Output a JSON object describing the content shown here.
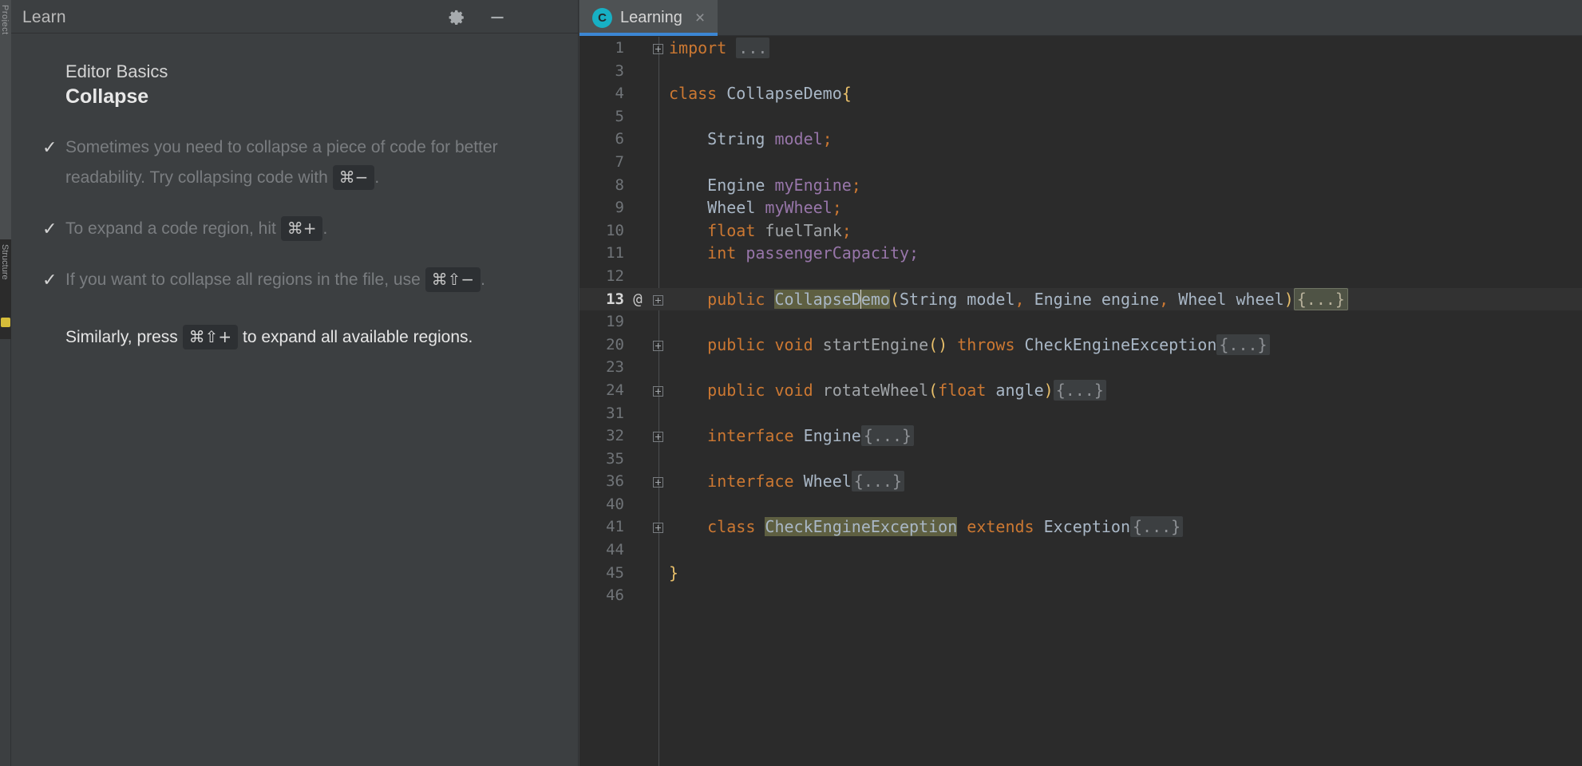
{
  "left_stripe": {
    "tab_label_top": "Project",
    "tab_label_bottom": "Structure",
    "icon_name": "bulb-icon"
  },
  "learn_panel": {
    "title": "Learn",
    "gear_icon": "gear-icon",
    "minimize_icon": "minimize-icon",
    "module": "Editor Basics",
    "lesson": "Collapse",
    "tasks": [
      {
        "state": "done",
        "check": "✓",
        "parts": [
          {
            "type": "text",
            "value": "Sometimes you need to collapse a piece of code for better readability. Try collapsing code with "
          },
          {
            "type": "kbd",
            "value": "⌘−"
          },
          {
            "type": "text",
            "value": "."
          }
        ]
      },
      {
        "state": "done",
        "check": "✓",
        "parts": [
          {
            "type": "text",
            "value": "To expand a code region, hit "
          },
          {
            "type": "kbd",
            "value": "⌘+"
          },
          {
            "type": "text",
            "value": "."
          }
        ]
      },
      {
        "state": "done",
        "check": "✓",
        "parts": [
          {
            "type": "text",
            "value": "If you want to collapse all regions in the file, use "
          },
          {
            "type": "kbd",
            "value": "⌘⇧−"
          },
          {
            "type": "text",
            "value": "."
          }
        ]
      }
    ],
    "final_note": [
      {
        "type": "text",
        "value": "Similarly, press "
      },
      {
        "type": "kbd",
        "value": "⌘⇧+"
      },
      {
        "type": "text",
        "value": " to expand all available regions."
      }
    ]
  },
  "editor": {
    "tab": {
      "icon_letter": "C",
      "icon_name": "java-class-icon",
      "label": "Learning",
      "close_icon": "×"
    },
    "colors": {
      "background": "#2b2b2b",
      "caret_line": "#323232",
      "keyword": "#cc7832",
      "type": "#a9b7c6",
      "field": "#9876aa",
      "brace": "#e8bf6a",
      "fold": "#3c3f41",
      "identifier_highlight": "#5e5f41",
      "tab_underline": "#3c86d3",
      "tab_icon": "#17b0c4"
    },
    "lines": [
      {
        "num": "1",
        "fold": true,
        "ann": "",
        "caret": false,
        "tokens": [
          {
            "c": "kw",
            "t": "import"
          },
          {
            "c": "plain",
            "t": " "
          },
          {
            "c": "fold",
            "t": "..."
          }
        ]
      },
      {
        "num": "3",
        "fold": false,
        "ann": "",
        "caret": false,
        "tokens": []
      },
      {
        "num": "4",
        "fold": false,
        "ann": "",
        "caret": false,
        "tokens": [
          {
            "c": "kw",
            "t": "class"
          },
          {
            "c": "typ",
            "t": " CollapseDemo"
          },
          {
            "c": "brace",
            "t": "{"
          }
        ]
      },
      {
        "num": "5",
        "fold": false,
        "ann": "",
        "caret": false,
        "tokens": []
      },
      {
        "num": "6",
        "fold": false,
        "ann": "",
        "caret": false,
        "tokens": [
          {
            "c": "typ",
            "t": "    String "
          },
          {
            "c": "fld",
            "t": "model"
          },
          {
            "c": "kw",
            "t": ";"
          }
        ]
      },
      {
        "num": "7",
        "fold": false,
        "ann": "",
        "caret": false,
        "tokens": []
      },
      {
        "num": "8",
        "fold": false,
        "ann": "",
        "caret": false,
        "tokens": [
          {
            "c": "typ",
            "t": "    Engine "
          },
          {
            "c": "fld",
            "t": "myEngine"
          },
          {
            "c": "kw",
            "t": ";"
          }
        ]
      },
      {
        "num": "9",
        "fold": false,
        "ann": "",
        "caret": false,
        "tokens": [
          {
            "c": "typ",
            "t": "    Wheel "
          },
          {
            "c": "fld",
            "t": "myWheel"
          },
          {
            "c": "kw",
            "t": ";"
          }
        ]
      },
      {
        "num": "10",
        "fold": false,
        "ann": "",
        "caret": false,
        "tokens": [
          {
            "c": "kw",
            "t": "    float"
          },
          {
            "c": "meth",
            "t": " fuelTank"
          },
          {
            "c": "kw",
            "t": ";"
          }
        ]
      },
      {
        "num": "11",
        "fold": false,
        "ann": "",
        "caret": false,
        "tokens": [
          {
            "c": "kw",
            "t": "    int"
          },
          {
            "c": "fld",
            "t": " passengerCapacity"
          },
          {
            "c": "fld",
            "t": ";"
          }
        ]
      },
      {
        "num": "12",
        "fold": false,
        "ann": "",
        "caret": false,
        "tokens": []
      },
      {
        "num": "13",
        "fold": true,
        "ann": "@",
        "caret": true,
        "tokens": [
          {
            "c": "kw",
            "t": "    public"
          },
          {
            "c": "plain",
            "t": " "
          },
          {
            "c": "ident-hl",
            "t": "CollapseD",
            "caretAfter": true
          },
          {
            "c": "ident-hl",
            "t": "emo"
          },
          {
            "c": "brace",
            "t": "("
          },
          {
            "c": "typ",
            "t": "String model"
          },
          {
            "c": "kw",
            "t": ","
          },
          {
            "c": "typ",
            "t": " Engine engine"
          },
          {
            "c": "kw",
            "t": ","
          },
          {
            "c": "typ",
            "t": " Wheel wheel"
          },
          {
            "c": "brace",
            "t": ")"
          },
          {
            "c": "fold sel",
            "t": "{...}"
          }
        ]
      },
      {
        "num": "19",
        "fold": false,
        "ann": "",
        "caret": false,
        "tokens": []
      },
      {
        "num": "20",
        "fold": true,
        "ann": "",
        "caret": false,
        "tokens": [
          {
            "c": "kw",
            "t": "    public void"
          },
          {
            "c": "meth",
            "t": " startEngine"
          },
          {
            "c": "brace",
            "t": "()"
          },
          {
            "c": "kw",
            "t": " throws"
          },
          {
            "c": "typ",
            "t": " CheckEngineException"
          },
          {
            "c": "fold",
            "t": "{...}"
          }
        ]
      },
      {
        "num": "23",
        "fold": false,
        "ann": "",
        "caret": false,
        "tokens": []
      },
      {
        "num": "24",
        "fold": true,
        "ann": "",
        "caret": false,
        "tokens": [
          {
            "c": "kw",
            "t": "    public void"
          },
          {
            "c": "meth",
            "t": " rotateWheel"
          },
          {
            "c": "brace",
            "t": "("
          },
          {
            "c": "kw",
            "t": "float"
          },
          {
            "c": "typ",
            "t": " angle"
          },
          {
            "c": "brace",
            "t": ")"
          },
          {
            "c": "fold",
            "t": "{...}"
          }
        ]
      },
      {
        "num": "31",
        "fold": false,
        "ann": "",
        "caret": false,
        "tokens": []
      },
      {
        "num": "32",
        "fold": true,
        "ann": "",
        "caret": false,
        "tokens": [
          {
            "c": "kw",
            "t": "    interface"
          },
          {
            "c": "typ",
            "t": " Engine"
          },
          {
            "c": "fold",
            "t": "{...}"
          }
        ]
      },
      {
        "num": "35",
        "fold": false,
        "ann": "",
        "caret": false,
        "tokens": []
      },
      {
        "num": "36",
        "fold": true,
        "ann": "",
        "caret": false,
        "tokens": [
          {
            "c": "kw",
            "t": "    interface"
          },
          {
            "c": "typ",
            "t": " Wheel"
          },
          {
            "c": "fold",
            "t": "{...}"
          }
        ]
      },
      {
        "num": "40",
        "fold": false,
        "ann": "",
        "caret": false,
        "tokens": []
      },
      {
        "num": "41",
        "fold": true,
        "ann": "",
        "caret": false,
        "tokens": [
          {
            "c": "kw",
            "t": "    class"
          },
          {
            "c": "plain",
            "t": " "
          },
          {
            "c": "ident-hl",
            "t": "CheckEngineException"
          },
          {
            "c": "kw",
            "t": " extends"
          },
          {
            "c": "typ",
            "t": " Exception"
          },
          {
            "c": "fold",
            "t": "{...}"
          }
        ]
      },
      {
        "num": "44",
        "fold": false,
        "ann": "",
        "caret": false,
        "tokens": []
      },
      {
        "num": "45",
        "fold": false,
        "ann": "",
        "caret": false,
        "tokens": [
          {
            "c": "brace",
            "t": "}"
          }
        ]
      },
      {
        "num": "46",
        "fold": false,
        "ann": "",
        "caret": false,
        "tokens": []
      }
    ]
  }
}
